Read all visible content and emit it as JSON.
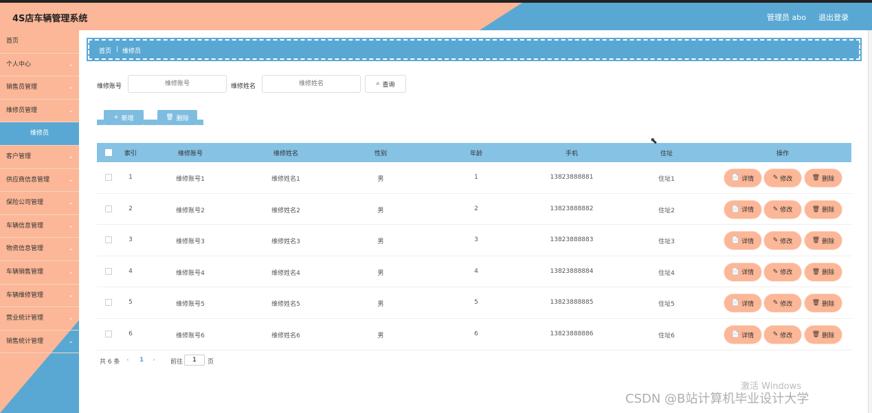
{
  "app": {
    "title": "4S店车辆管理系统",
    "user_label": "管理员 abo",
    "logout_label": "退出登录"
  },
  "sidebar": {
    "items": [
      {
        "label": "首页",
        "chevron": ""
      },
      {
        "label": "个人中心",
        "chevron": "⌄"
      },
      {
        "label": "销售员管理",
        "chevron": "⌄"
      },
      {
        "label": "维修员管理",
        "chevron": "⌄"
      },
      {
        "label": "维修员",
        "chevron": ""
      },
      {
        "label": "客户管理",
        "chevron": "⌄"
      },
      {
        "label": "供应商信息管理",
        "chevron": "⌄"
      },
      {
        "label": "保险公司管理",
        "chevron": "⌄"
      },
      {
        "label": "车辆信息管理",
        "chevron": "⌄"
      },
      {
        "label": "物资信息管理",
        "chevron": "⌄"
      },
      {
        "label": "车辆销售管理",
        "chevron": "⌄"
      },
      {
        "label": "车辆维修管理",
        "chevron": "⌄"
      },
      {
        "label": "营业统计管理",
        "chevron": "⌄"
      },
      {
        "label": "销售统计管理",
        "chevron": "⌄"
      }
    ]
  },
  "breadcrumb": {
    "home": "首页",
    "separator": "|",
    "current": "维修员"
  },
  "search": {
    "account_label": "维修账号",
    "account_placeholder": "维修账号",
    "name_label": "维修姓名",
    "name_placeholder": "维修姓名",
    "query_label": "查询"
  },
  "actions": {
    "add_label": "新增",
    "delete_label": "删除"
  },
  "table": {
    "headers": {
      "index": "索引",
      "account": "维修账号",
      "name": "维修姓名",
      "gender": "性别",
      "age": "年龄",
      "phone": "手机",
      "address": "住址",
      "ops": "操作"
    },
    "rows": [
      {
        "index": "1",
        "account": "维修账号1",
        "name": "维修姓名1",
        "gender": "男",
        "age": "1",
        "phone": "13823888881",
        "address": "住址1"
      },
      {
        "index": "2",
        "account": "维修账号2",
        "name": "维修姓名2",
        "gender": "男",
        "age": "2",
        "phone": "13823888882",
        "address": "住址2"
      },
      {
        "index": "3",
        "account": "维修账号3",
        "name": "维修姓名3",
        "gender": "男",
        "age": "3",
        "phone": "13823888883",
        "address": "住址3"
      },
      {
        "index": "4",
        "account": "维修账号4",
        "name": "维修姓名4",
        "gender": "男",
        "age": "4",
        "phone": "13823888884",
        "address": "住址4"
      },
      {
        "index": "5",
        "account": "维修账号5",
        "name": "维修姓名5",
        "gender": "男",
        "age": "5",
        "phone": "13823888885",
        "address": "住址5"
      },
      {
        "index": "6",
        "account": "维修账号6",
        "name": "维修姓名6",
        "gender": "男",
        "age": "6",
        "phone": "13823888886",
        "address": "住址6"
      }
    ],
    "row_actions": {
      "detail": "详情",
      "edit": "修改",
      "delete": "删除"
    }
  },
  "pagination": {
    "total": "共 6 条",
    "prev": "‹",
    "page": "1",
    "next": "›",
    "goto_label": "前往",
    "goto_value": "1",
    "page_suffix": "页"
  },
  "watermarks": {
    "windows": "激活 Windows",
    "csdn": "CSDN @B站计算机毕业设计大学"
  },
  "colors": {
    "peach": "#fbb797",
    "blue": "#59a8d3",
    "header_blue": "#86c2e3"
  }
}
